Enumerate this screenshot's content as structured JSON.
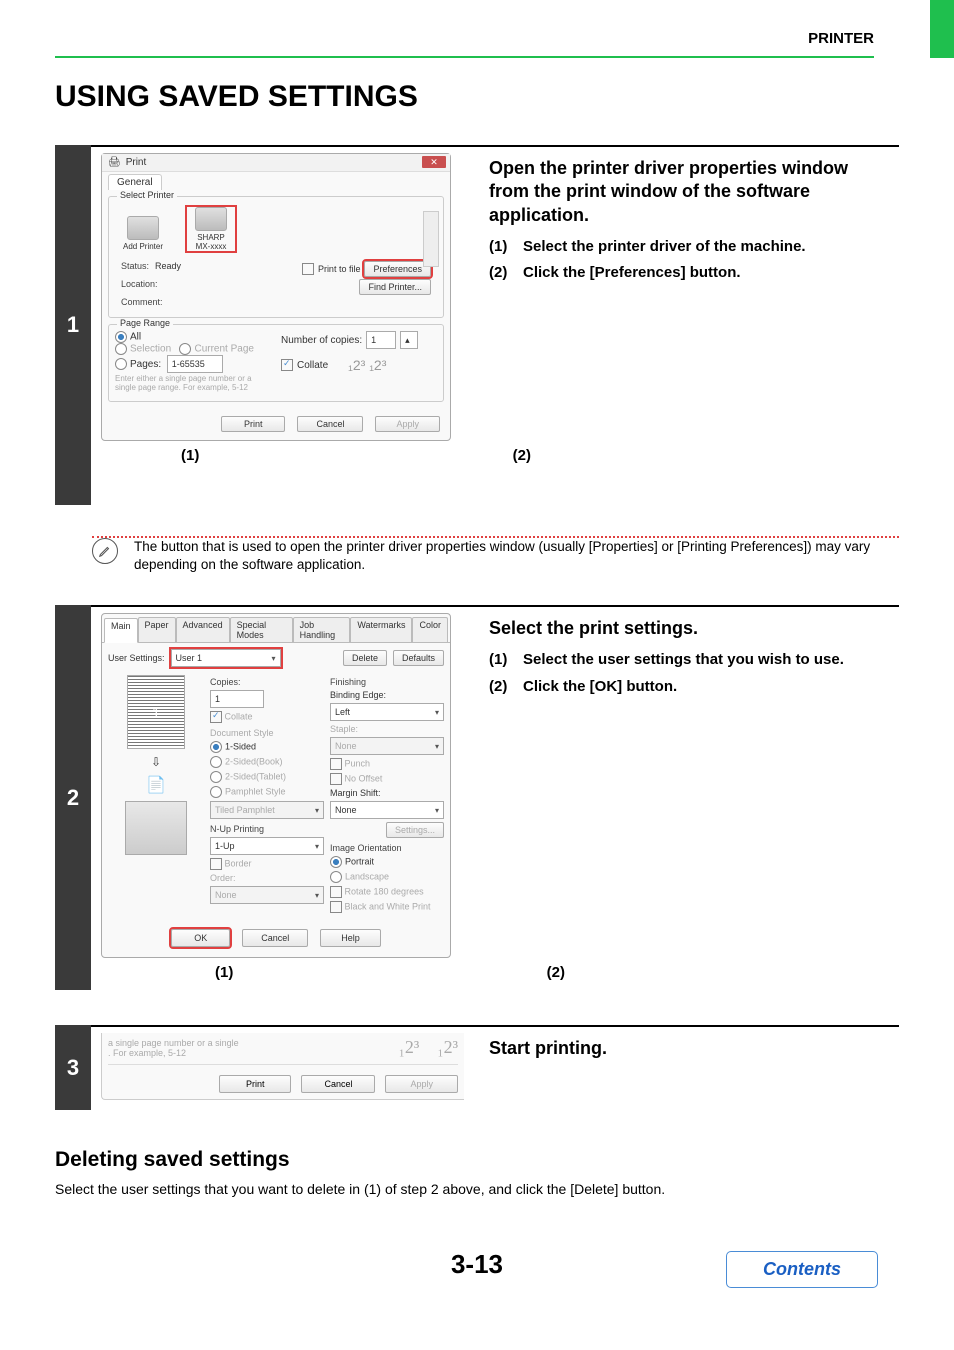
{
  "header": {
    "label": "PRINTER"
  },
  "title": "USING SAVED SETTINGS",
  "step1": {
    "num": "1",
    "title": "Open the printer driver properties window from the print window of the software application.",
    "sub1_num": "(1)",
    "sub1_text": "Select the printer driver of the machine.",
    "sub2_num": "(2)",
    "sub2_text": "Click the [Preferences] button.",
    "callout1": "(1)",
    "callout2": "(2)",
    "note": "The button that is used to open the printer driver properties window (usually [Properties] or [Printing Preferences]) may vary depending on the software application.",
    "dlg": {
      "title": "Print",
      "tab_general": "General",
      "group_printer": "Select Printer",
      "add_printer": "Add Printer",
      "sharp": "SHARP\nMX-xxxx",
      "status_lbl": "Status:",
      "status_val": "Ready",
      "location_lbl": "Location:",
      "comment_lbl": "Comment:",
      "print_to_file": "Print to file",
      "preferences_btn": "Preferences",
      "find_printer_btn": "Find Printer...",
      "group_range": "Page Range",
      "all": "All",
      "selection": "Selection",
      "current_page": "Current Page",
      "pages_lbl": "Pages:",
      "pages_val": "1-65535",
      "pages_hint": "Enter either a single page number or a single page range.  For example, 5-12",
      "copies_lbl": "Number of copies:",
      "copies_val": "1",
      "collate": "Collate",
      "print_btn": "Print",
      "cancel_btn": "Cancel",
      "apply_btn": "Apply"
    }
  },
  "step2": {
    "num": "2",
    "title": "Select the print settings.",
    "sub1_num": "(1)",
    "sub1_text": "Select the user settings that you wish to use.",
    "sub2_num": "(2)",
    "sub2_text": "Click the [OK] button.",
    "callout1": "(1)",
    "callout2": "(2)",
    "dlg": {
      "tabs": [
        "Main",
        "Paper",
        "Advanced",
        "Special Modes",
        "Job Handling",
        "Watermarks",
        "Color"
      ],
      "user_settings_lbl": "User Settings:",
      "user_settings_val": "User 1",
      "delete_btn": "Delete",
      "defaults_btn": "Defaults",
      "copies_lbl": "Copies:",
      "copies_val": "1",
      "collate": "Collate",
      "doc_style": "Document Style",
      "one_sided": "1-Sided",
      "two_sided_book": "2-Sided(Book)",
      "two_sided_tablet": "2-Sided(Tablet)",
      "pamphlet_style": "Pamphlet Style",
      "tiled_pamphlet": "Tiled Pamphlet",
      "nup_lbl": "N-Up Printing",
      "nup_val": "1-Up",
      "border": "Border",
      "order_lbl": "Order:",
      "order_val": "None",
      "finishing": "Finishing",
      "binding_edge": "Binding Edge:",
      "binding_val": "Left",
      "staple_lbl": "Staple:",
      "staple_val": "None",
      "punch": "Punch",
      "no_offset": "No Offset",
      "margin_lbl": "Margin Shift:",
      "margin_val": "None",
      "settings_btn": "Settings...",
      "img_orient": "Image Orientation",
      "portrait": "Portrait",
      "landscape": "Landscape",
      "rotate": "Rotate 180 degrees",
      "bw": "Black and White Print",
      "ok_btn": "OK",
      "cancel_btn": "Cancel",
      "help_btn": "Help",
      "preview_page_num": "1"
    }
  },
  "step3": {
    "num": "3",
    "title": "Start printing.",
    "hint": "a single page number or a single\n.  For example, 5-12",
    "print_btn": "Print",
    "cancel_btn": "Cancel",
    "apply_btn": "Apply"
  },
  "deleting": {
    "heading": "Deleting saved settings",
    "text": "Select the user settings that you want to delete in (1) of step 2 above, and click the [Delete] button."
  },
  "page_number": "3-13",
  "contents_btn": "Contents"
}
